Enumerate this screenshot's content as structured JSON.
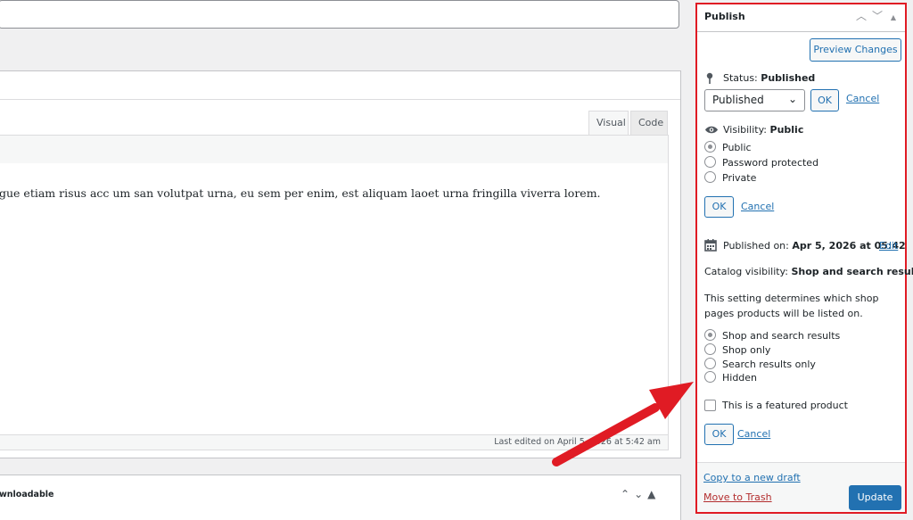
{
  "editor": {
    "tabs": {
      "visual": "Visual",
      "code": "Code"
    },
    "content_text": "gue etiam risus acc um san volutpat urna, eu sem per enim, est aliquam laoet urna fringilla viverra lorem.",
    "last_edited": "Last edited on April 5, 2026 at 5:42 am"
  },
  "downloadable": {
    "label": "wnloadable"
  },
  "publish": {
    "title": "Publish",
    "preview_button": "Preview Changes",
    "status": {
      "label": "Status:",
      "value": "Published",
      "select_value": "Published",
      "ok": "OK",
      "cancel": "Cancel"
    },
    "visibility": {
      "label": "Visibility:",
      "value": "Public",
      "options": [
        "Public",
        "Password protected",
        "Private"
      ],
      "selected": "Public",
      "ok": "OK",
      "cancel": "Cancel"
    },
    "published_on": {
      "label": "Published on:",
      "value": "Apr 5, 2026 at 05:42",
      "edit": "Edit"
    },
    "catalog": {
      "label": "Catalog visibility:",
      "value": "Shop and search results",
      "description": "This setting determines which shop pages products will be listed on.",
      "options": [
        "Shop and search results",
        "Shop only",
        "Search results only",
        "Hidden"
      ],
      "selected": "Shop and search results",
      "featured": "This is a featured product",
      "ok": "OK",
      "cancel": "Cancel"
    },
    "copy_draft": "Copy to a new draft",
    "trash": "Move to Trash",
    "update": "Update"
  },
  "colors": {
    "highlight": "#e01b24",
    "accent": "#2271b1",
    "danger": "#b32d2e"
  },
  "icons": [
    "pin-icon",
    "eye-icon",
    "calendar-icon",
    "chevron-up-icon",
    "chevron-down-icon",
    "caret-up-icon",
    "red-arrow-annotation"
  ]
}
